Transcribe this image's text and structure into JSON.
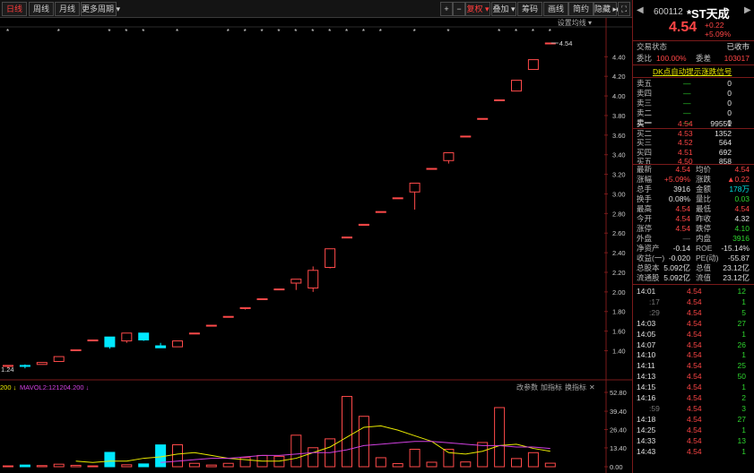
{
  "toolbar": {
    "periods": [
      "日线",
      "周线",
      "月线",
      "更多周期 ▾"
    ],
    "right_buttons": [
      "+",
      "−",
      "复权 ▾",
      "叠加 ▾",
      "筹码",
      "画线",
      "简约",
      "隐藏 ▸▸"
    ],
    "setting_label": "设置均线 ▾"
  },
  "price_axis": [
    "4.40",
    "4.20",
    "4.00",
    "3.80",
    "3.60",
    "3.40",
    "3.20",
    "3.00",
    "2.80",
    "2.60",
    "2.40",
    "2.20",
    "2.00",
    "1.80",
    "1.60",
    "1.40"
  ],
  "vol_axis": [
    "52.80",
    "39.40",
    "26.40",
    "13.40",
    "0.00"
  ],
  "labels": {
    "price_high": "4.54",
    "price_low": "1.24"
  },
  "vol_indicator": {
    "prefix": "200 ↓",
    "ma_text": "MAVOL2:121204.200 ↓",
    "buttons": [
      "改参数",
      "加指标",
      "换指标"
    ],
    "close": "✕"
  },
  "colors": {
    "up": "#ff4a4a",
    "down": "#00e8ff",
    "ma_yellow": "#e8e800",
    "ma_purple": "#d040e0"
  },
  "chart_data": {
    "type": "candlestick",
    "ylim": [
      1.24,
      4.54
    ],
    "candles": [
      {
        "o": 1.24,
        "h": 1.25,
        "l": 1.22,
        "c": 1.25
      },
      {
        "o": 1.25,
        "h": 1.26,
        "l": 1.22,
        "c": 1.24
      },
      {
        "o": 1.26,
        "h": 1.28,
        "l": 1.26,
        "c": 1.28
      },
      {
        "o": 1.29,
        "h": 1.34,
        "l": 1.29,
        "c": 1.34
      },
      {
        "o": 1.4,
        "h": 1.41,
        "l": 1.4,
        "c": 1.41
      },
      {
        "o": 1.5,
        "h": 1.51,
        "l": 1.5,
        "c": 1.51
      },
      {
        "o": 1.54,
        "h": 1.54,
        "l": 1.42,
        "c": 1.44
      },
      {
        "o": 1.5,
        "h": 1.58,
        "l": 1.48,
        "c": 1.58
      },
      {
        "o": 1.58,
        "h": 1.58,
        "l": 1.5,
        "c": 1.51
      },
      {
        "o": 1.45,
        "h": 1.48,
        "l": 1.43,
        "c": 1.43
      },
      {
        "o": 1.44,
        "h": 1.5,
        "l": 1.44,
        "c": 1.5
      },
      {
        "o": 1.58,
        "h": 1.58,
        "l": 1.58,
        "c": 1.58
      },
      {
        "o": 1.66,
        "h": 1.66,
        "l": 1.66,
        "c": 1.66
      },
      {
        "o": 1.75,
        "h": 1.75,
        "l": 1.74,
        "c": 1.75
      },
      {
        "o": 1.83,
        "h": 1.84,
        "l": 1.82,
        "c": 1.84
      },
      {
        "o": 1.93,
        "h": 1.93,
        "l": 1.93,
        "c": 1.93
      },
      {
        "o": 2.03,
        "h": 2.03,
        "l": 2.03,
        "c": 2.03
      },
      {
        "o": 2.09,
        "h": 2.13,
        "l": 2.02,
        "c": 2.13
      },
      {
        "o": 2.04,
        "h": 2.26,
        "l": 2.0,
        "c": 2.22
      },
      {
        "o": 2.25,
        "h": 2.44,
        "l": 2.24,
        "c": 2.44
      },
      {
        "o": 2.55,
        "h": 2.56,
        "l": 2.55,
        "c": 2.56
      },
      {
        "o": 2.68,
        "h": 2.69,
        "l": 2.68,
        "c": 2.69
      },
      {
        "o": 2.82,
        "h": 2.82,
        "l": 2.82,
        "c": 2.82
      },
      {
        "o": 2.96,
        "h": 2.96,
        "l": 2.96,
        "c": 2.96
      },
      {
        "o": 3.02,
        "h": 3.11,
        "l": 2.84,
        "c": 3.11
      },
      {
        "o": 3.26,
        "h": 3.26,
        "l": 3.26,
        "c": 3.26
      },
      {
        "o": 3.34,
        "h": 3.42,
        "l": 3.31,
        "c": 3.42
      },
      {
        "o": 3.59,
        "h": 3.59,
        "l": 3.59,
        "c": 3.59
      },
      {
        "o": 3.77,
        "h": 3.77,
        "l": 3.77,
        "c": 3.77
      },
      {
        "o": 3.96,
        "h": 3.96,
        "l": 3.96,
        "c": 3.96
      },
      {
        "o": 4.05,
        "h": 4.16,
        "l": 4.05,
        "c": 4.16
      },
      {
        "o": 4.27,
        "h": 4.37,
        "l": 4.27,
        "c": 4.37
      },
      {
        "o": 4.54,
        "h": 4.54,
        "l": 4.54,
        "c": 4.54
      }
    ],
    "volume": [
      0.6,
      1.2,
      0.8,
      1.8,
      1.0,
      0.6,
      10.2,
      1.4,
      2.0,
      15.5,
      15.6,
      2.4,
      1.2,
      2.4,
      6.5,
      8.0,
      7.4,
      22.4,
      13.5,
      19.8,
      49.9,
      35.8,
      6.4,
      2.2,
      12.4,
      3.2,
      12.4,
      3.4,
      17.2,
      42.0,
      5.8,
      10.0,
      2.5
    ],
    "ma_yellow": [
      null,
      null,
      null,
      null,
      4,
      3,
      4,
      4,
      6,
      7,
      9,
      10,
      8,
      6,
      5,
      4,
      4,
      6,
      10,
      14,
      21,
      28,
      29,
      26,
      22,
      18,
      10,
      9,
      11,
      15,
      16,
      13,
      11
    ],
    "ma_purple": [
      null,
      null,
      null,
      null,
      null,
      null,
      null,
      null,
      null,
      3,
      4,
      5,
      6,
      6,
      7,
      8,
      8,
      9,
      10,
      10,
      12,
      15,
      16,
      17,
      18,
      18,
      17,
      16,
      15,
      15,
      14,
      14,
      13
    ],
    "stars": [
      0,
      3,
      6,
      7,
      8,
      10,
      13,
      14,
      15,
      16,
      17,
      18,
      19,
      20,
      21,
      22,
      24,
      26,
      29,
      30,
      31,
      32
    ]
  },
  "quote": {
    "code": "600112",
    "name": "*ST天成",
    "price": "4.54",
    "chg": "+0.22",
    "pct": "+5.09%",
    "status_label": "交易状态",
    "status_value": "已收市",
    "webi_label": "委比",
    "webi_value": "100.00%",
    "weicha_label": "委差",
    "weicha_value": "103017",
    "signal_text": "DK点自动提示涨跌信号",
    "asks": [
      {
        "label": "卖五",
        "price": "—",
        "vol": "0"
      },
      {
        "label": "卖四",
        "price": "—",
        "vol": "0"
      },
      {
        "label": "卖三",
        "price": "—",
        "vol": "0"
      },
      {
        "label": "卖二",
        "price": "—",
        "vol": "0"
      },
      {
        "label": "卖一",
        "price": "—",
        "vol": "0"
      }
    ],
    "bids": [
      {
        "label": "买一",
        "price": "4.54",
        "vol": "99551"
      },
      {
        "label": "买二",
        "price": "4.53",
        "vol": "1352"
      },
      {
        "label": "买三",
        "price": "4.52",
        "vol": "564"
      },
      {
        "label": "买四",
        "price": "4.51",
        "vol": "692"
      },
      {
        "label": "买五",
        "price": "4.50",
        "vol": "858"
      }
    ],
    "stats": [
      {
        "l1": "最新",
        "v1": "4.54",
        "c1": "r",
        "l2": "均价",
        "v2": "4.54",
        "c2": "r"
      },
      {
        "l1": "涨幅",
        "v1": "+5.09%",
        "c1": "r",
        "l2": "涨跌",
        "v2": "▲0.22",
        "c2": "r"
      },
      {
        "l1": "总手",
        "v1": "3916",
        "c1": "w",
        "l2": "金额",
        "v2": "178万",
        "c2": "c"
      },
      {
        "l1": "换手",
        "v1": "0.08%",
        "c1": "w",
        "l2": "量比",
        "v2": "0.03",
        "c2": "g"
      },
      {
        "l1": "最高",
        "v1": "4.54",
        "c1": "r",
        "l2": "最低",
        "v2": "4.54",
        "c2": "r"
      },
      {
        "l1": "今开",
        "v1": "4.54",
        "c1": "r",
        "l2": "昨收",
        "v2": "4.32",
        "c2": "w"
      },
      {
        "l1": "涨停",
        "v1": "4.54",
        "c1": "r",
        "l2": "跌停",
        "v2": "4.10",
        "c2": "g"
      },
      {
        "l1": "外盘",
        "v1": "—",
        "c1": "dim",
        "l2": "内盘",
        "v2": "3916",
        "c2": "g"
      },
      {
        "l1": "净资产",
        "v1": "-0.14",
        "c1": "w",
        "l2": "ROE",
        "v2": "-15.14%",
        "c2": "w"
      },
      {
        "l1": "收益(一)",
        "v1": "-0.020",
        "c1": "w",
        "l2": "PE(动)",
        "v2": "-55.87",
        "c2": "w"
      },
      {
        "l1": "总股本",
        "v1": "5.092亿",
        "c1": "w",
        "l2": "总值",
        "v2": "23.12亿",
        "c2": "w"
      },
      {
        "l1": "流通股",
        "v1": "5.092亿",
        "c1": "w",
        "l2": "流值",
        "v2": "23.12亿",
        "c2": "w"
      }
    ],
    "ticks": [
      {
        "t": "14:01",
        "p": "4.54",
        "v": "12",
        "vc": "g"
      },
      {
        "t": ":17",
        "p": "4.54",
        "v": "1",
        "vc": "g"
      },
      {
        "t": ":29",
        "p": "4.54",
        "v": "5",
        "vc": "g"
      },
      {
        "t": "14:03",
        "p": "4.54",
        "v": "27",
        "vc": "g"
      },
      {
        "t": "14:05",
        "p": "4.54",
        "v": "1",
        "vc": "g"
      },
      {
        "t": "14:07",
        "p": "4.54",
        "v": "26",
        "vc": "g"
      },
      {
        "t": "14:10",
        "p": "4.54",
        "v": "1",
        "vc": "g"
      },
      {
        "t": "14:11",
        "p": "4.54",
        "v": "25",
        "vc": "g"
      },
      {
        "t": "14:13",
        "p": "4.54",
        "v": "50",
        "vc": "g"
      },
      {
        "t": "14:15",
        "p": "4.54",
        "v": "1",
        "vc": "g"
      },
      {
        "t": "14:16",
        "p": "4.54",
        "v": "2",
        "vc": "g"
      },
      {
        "t": ":59",
        "p": "4.54",
        "v": "3",
        "vc": "g"
      },
      {
        "t": "14:18",
        "p": "4.54",
        "v": "27",
        "vc": "g"
      },
      {
        "t": "14:25",
        "p": "4.54",
        "v": "1",
        "vc": "g"
      },
      {
        "t": "14:33",
        "p": "4.54",
        "v": "13",
        "vc": "g"
      },
      {
        "t": "14:43",
        "p": "4.54",
        "v": "1",
        "vc": "g"
      }
    ]
  }
}
